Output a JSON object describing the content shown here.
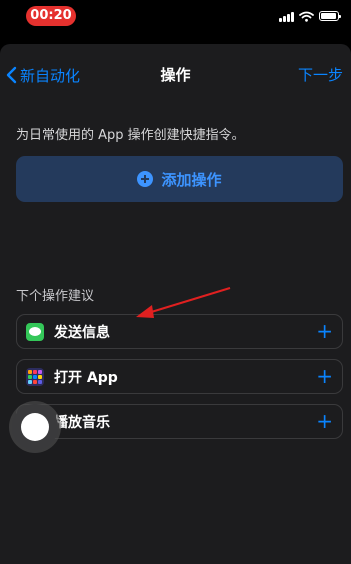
{
  "status_bar": {
    "time": "00:20"
  },
  "nav": {
    "back_label": "新自动化",
    "title": "操作",
    "next_label": "下一步"
  },
  "description": "为日常使用的 App 操作创建快捷指令。",
  "add_action_label": "添加操作",
  "suggestions_title": "下个操作建议",
  "suggestions": [
    {
      "label": "发送信息",
      "icon": "messages-app-icon"
    },
    {
      "label": "打开 App",
      "icon": "app-grid-icon"
    },
    {
      "label": "播放音乐",
      "icon": "music-app-icon"
    }
  ],
  "plus_symbol": "+",
  "colors": {
    "accent": "#0a84ff",
    "annotation_arrow": "#e02020",
    "time_pill": "#e5312e"
  }
}
